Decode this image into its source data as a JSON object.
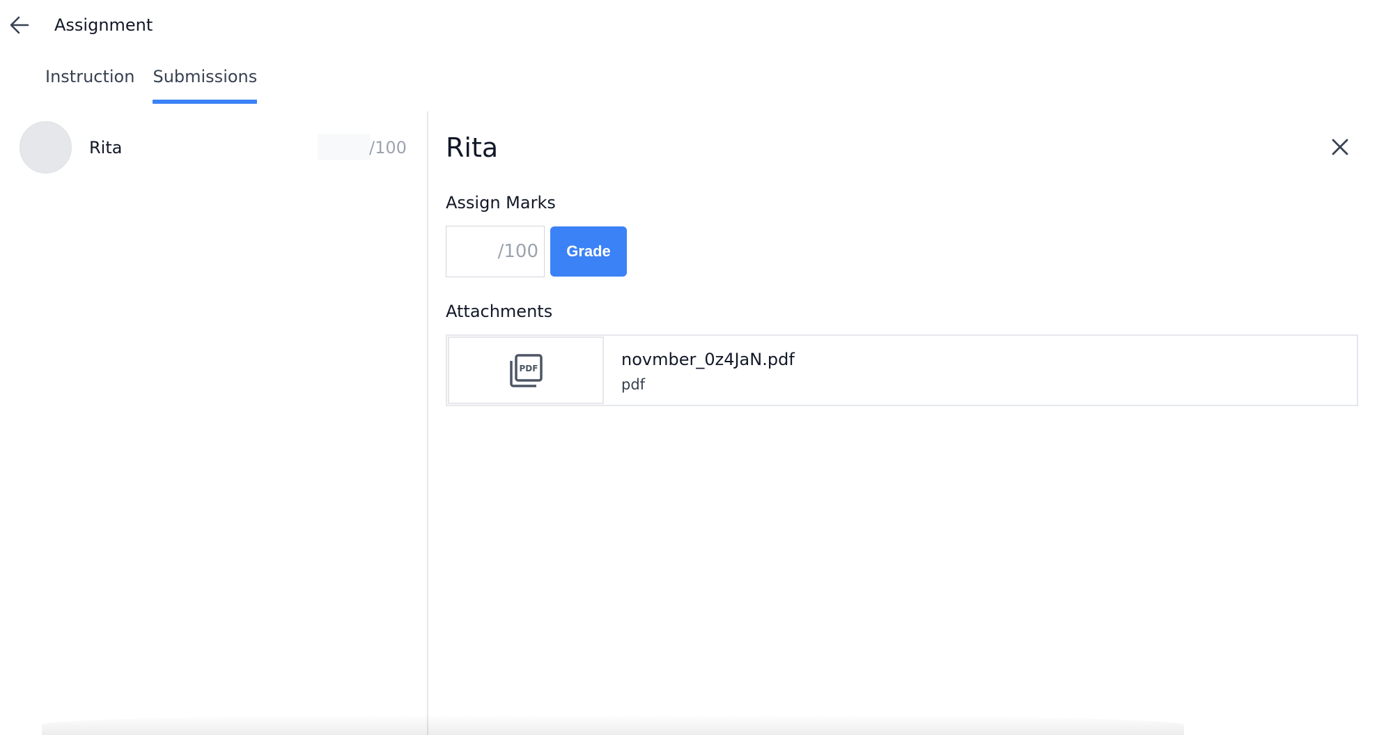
{
  "header": {
    "title": "Assignment",
    "back_icon": "arrow-left-icon"
  },
  "tabs": [
    {
      "label": "Instruction",
      "active": false
    },
    {
      "label": "Submissions",
      "active": true
    }
  ],
  "colors": {
    "accent": "#3b82f6",
    "avatar_bg": "#e5e7eb",
    "muted_text": "#9ca3af"
  },
  "submissions": [
    {
      "name": "Rita",
      "score": "",
      "total": "/100"
    }
  ],
  "detail": {
    "student_name": "Rita",
    "close_icon": "close-icon",
    "assign_marks_label": "Assign Marks",
    "marks_value": "",
    "marks_total": "/100",
    "grade_label": "Grade",
    "attachments_label": "Attachments",
    "attachments": [
      {
        "file_name": "novmber_0z4JaN.pdf",
        "file_type": "pdf",
        "icon": "pdf-file-icon"
      }
    ]
  }
}
